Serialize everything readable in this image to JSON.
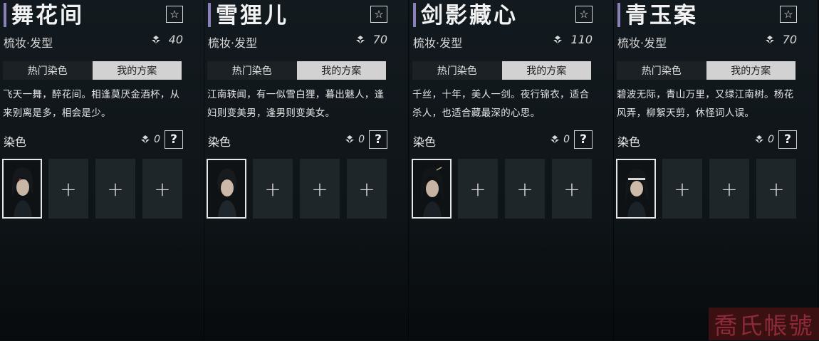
{
  "colors": {
    "accent": "#8c80b8",
    "active_tab": "#d2d2d2",
    "watermark_bg": "#3a1010"
  },
  "icons": {
    "favorite": "star-icon",
    "currency": "gem-icon",
    "help": "question-icon",
    "add": "plus-icon"
  },
  "cards": [
    {
      "title": "舞花间",
      "subtitle": "梳妆·发型",
      "cost": "40",
      "tabs": [
        "热门染色",
        "我的方案"
      ],
      "active_tab": 1,
      "description": "飞天一舞，醉花间。相逢莫厌金酒杯，从来别离是多，相会是少。",
      "dye_label": "染色",
      "dye_count": "0",
      "star": "☆",
      "help": "?",
      "add_symbol": "+"
    },
    {
      "title": "雪狸儿",
      "subtitle": "梳妆·发型",
      "cost": "70",
      "tabs": [
        "热门染色",
        "我的方案"
      ],
      "active_tab": 1,
      "description": "江南轶闻，有一似雪白狸，暮出魅人，逢妇则变美男，逢男则变美女。",
      "dye_label": "染色",
      "dye_count": "0",
      "star": "☆",
      "help": "?",
      "add_symbol": "+"
    },
    {
      "title": "剑影藏心",
      "subtitle": "梳妆·发型",
      "cost": "110",
      "tabs": [
        "热门染色",
        "我的方案"
      ],
      "active_tab": 1,
      "description": "千丝，十年，美人一剑。夜行锦衣，适合杀人，也适合藏最深的心思。",
      "dye_label": "染色",
      "dye_count": "0",
      "star": "☆",
      "help": "?",
      "add_symbol": "+"
    },
    {
      "title": "青玉案",
      "subtitle": "梳妆·发型",
      "cost": "70",
      "tabs": [
        "热门染色",
        "我的方案"
      ],
      "active_tab": 1,
      "description": "碧波无际，青山万里，又绿江南树。杨花风弄，柳絮天剪，休怪词人误。",
      "dye_label": "染色",
      "dye_count": "0",
      "star": "☆",
      "help": "?",
      "add_symbol": "+"
    }
  ],
  "watermark": "喬氏帳號"
}
